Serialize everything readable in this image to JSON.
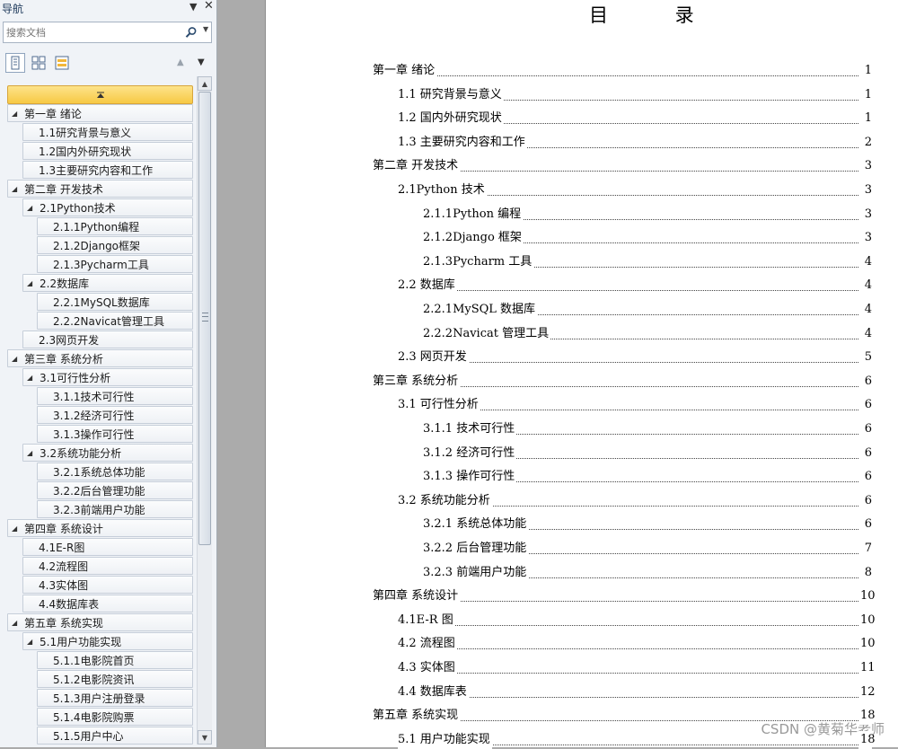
{
  "nav": {
    "title": "导航",
    "search_placeholder": "搜索文档",
    "collapse_label": "▲"
  },
  "tree": [
    {
      "label": "第一章 绪论",
      "level": 0,
      "toggle": true
    },
    {
      "label": "1.1研究背景与意义",
      "level": 1,
      "toggle": false
    },
    {
      "label": "1.2国内外研究现状",
      "level": 1,
      "toggle": false
    },
    {
      "label": "1.3主要研究内容和工作",
      "level": 1,
      "toggle": false
    },
    {
      "label": "第二章 开发技术",
      "level": 0,
      "toggle": true
    },
    {
      "label": "2.1Python技术",
      "level": 1,
      "toggle": true
    },
    {
      "label": "2.1.1Python编程",
      "level": 2,
      "toggle": false
    },
    {
      "label": "2.1.2Django框架",
      "level": 2,
      "toggle": false
    },
    {
      "label": "2.1.3Pycharm工具",
      "level": 2,
      "toggle": false
    },
    {
      "label": "2.2数据库",
      "level": 1,
      "toggle": true
    },
    {
      "label": "2.2.1MySQL数据库",
      "level": 2,
      "toggle": false
    },
    {
      "label": "2.2.2Navicat管理工具",
      "level": 2,
      "toggle": false
    },
    {
      "label": "2.3网页开发",
      "level": 1,
      "toggle": false
    },
    {
      "label": "第三章 系统分析",
      "level": 0,
      "toggle": true
    },
    {
      "label": "3.1可行性分析",
      "level": 1,
      "toggle": true
    },
    {
      "label": "3.1.1技术可行性",
      "level": 2,
      "toggle": false
    },
    {
      "label": "3.1.2经济可行性",
      "level": 2,
      "toggle": false
    },
    {
      "label": "3.1.3操作可行性",
      "level": 2,
      "toggle": false
    },
    {
      "label": "3.2系统功能分析",
      "level": 1,
      "toggle": true
    },
    {
      "label": "3.2.1系统总体功能",
      "level": 2,
      "toggle": false
    },
    {
      "label": "3.2.2后台管理功能",
      "level": 2,
      "toggle": false
    },
    {
      "label": "3.2.3前端用户功能",
      "level": 2,
      "toggle": false
    },
    {
      "label": "第四章 系统设计",
      "level": 0,
      "toggle": true
    },
    {
      "label": "4.1E-R图",
      "level": 1,
      "toggle": false
    },
    {
      "label": "4.2流程图",
      "level": 1,
      "toggle": false
    },
    {
      "label": "4.3实体图",
      "level": 1,
      "toggle": false
    },
    {
      "label": "4.4数据库表",
      "level": 1,
      "toggle": false
    },
    {
      "label": "第五章 系统实现",
      "level": 0,
      "toggle": true
    },
    {
      "label": "5.1用户功能实现",
      "level": 1,
      "toggle": true
    },
    {
      "label": "5.1.1电影院首页",
      "level": 2,
      "toggle": false
    },
    {
      "label": "5.1.2电影院资讯",
      "level": 2,
      "toggle": false
    },
    {
      "label": "5.1.3用户注册登录",
      "level": 2,
      "toggle": false
    },
    {
      "label": "5.1.4电影院购票",
      "level": 2,
      "toggle": false
    },
    {
      "label": "5.1.5用户中心",
      "level": 2,
      "toggle": false
    }
  ],
  "document": {
    "title": "目 录",
    "toc": [
      {
        "label": "第一章  绪论",
        "page": "1",
        "level": 0
      },
      {
        "label": "1.1 研究背景与意义",
        "page": "1",
        "level": 1
      },
      {
        "label": "1.2 国内外研究现状",
        "page": "1",
        "level": 1
      },
      {
        "label": "1.3 主要研究内容和工作",
        "page": "2",
        "level": 1
      },
      {
        "label": "第二章  开发技术",
        "page": "3",
        "level": 0
      },
      {
        "label": "2.1Python 技术",
        "page": "3",
        "level": 1
      },
      {
        "label": "2.1.1Python 编程",
        "page": "3",
        "level": 2
      },
      {
        "label": "2.1.2Django 框架",
        "page": "3",
        "level": 2
      },
      {
        "label": "2.1.3Pycharm 工具",
        "page": "4",
        "level": 2
      },
      {
        "label": "2.2 数据库",
        "page": "4",
        "level": 1
      },
      {
        "label": "2.2.1MySQL 数据库",
        "page": "4",
        "level": 2
      },
      {
        "label": "2.2.2Navicat 管理工具",
        "page": "4",
        "level": 2
      },
      {
        "label": "2.3 网页开发",
        "page": "5",
        "level": 1
      },
      {
        "label": "第三章  系统分析",
        "page": "6",
        "level": 0
      },
      {
        "label": "3.1 可行性分析",
        "page": "6",
        "level": 1
      },
      {
        "label": "3.1.1 技术可行性",
        "page": "6",
        "level": 2
      },
      {
        "label": "3.1.2 经济可行性",
        "page": "6",
        "level": 2
      },
      {
        "label": "3.1.3 操作可行性",
        "page": "6",
        "level": 2
      },
      {
        "label": "3.2 系统功能分析",
        "page": "6",
        "level": 1
      },
      {
        "label": "3.2.1 系统总体功能",
        "page": "6",
        "level": 2
      },
      {
        "label": "3.2.2 后台管理功能",
        "page": "7",
        "level": 2
      },
      {
        "label": "3.2.3 前端用户功能",
        "page": "8",
        "level": 2
      },
      {
        "label": "第四章  系统设计",
        "page": "10",
        "level": 0
      },
      {
        "label": "4.1E-R 图",
        "page": "10",
        "level": 1
      },
      {
        "label": "4.2 流程图",
        "page": "10",
        "level": 1
      },
      {
        "label": "4.3 实体图",
        "page": "11",
        "level": 1
      },
      {
        "label": "4.4 数据库表",
        "page": "12",
        "level": 1
      },
      {
        "label": "第五章  系统实现",
        "page": "18",
        "level": 0
      },
      {
        "label": "5.1 用户功能实现",
        "page": "18",
        "level": 1
      }
    ]
  },
  "watermark": "CSDN @黄菊华老师"
}
